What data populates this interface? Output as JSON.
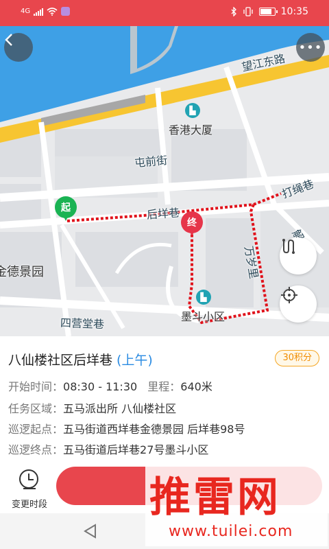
{
  "status_bar": {
    "network": "4G",
    "time": "10:35",
    "accent": "#e8464d"
  },
  "map": {
    "roads": {
      "wangjiang": "望江东路",
      "tunqian": "屯前街",
      "houyang": "后垟巷",
      "dasheng": "打绳巷",
      "wansui": "万岁里",
      "sibaitang": "四营堂巷",
      "jie": "解"
    },
    "pois": {
      "hongkong_building": "香港大厦",
      "modou_community": "墨斗小区",
      "jinde_garden": "金德景园"
    },
    "start_pin": "起",
    "end_pin": "终",
    "route_color": "#e0121b"
  },
  "task": {
    "title": "八仙楼社区后垟巷",
    "period": "(上午)",
    "points": "30积分",
    "start_time_label": "开始时间：",
    "start_time": "08:30 - 11:30",
    "distance_label": "里程：",
    "distance": "640米",
    "area_label": "任务区域：",
    "area": "五马派出所 八仙楼社区",
    "start_point_label": "巡逻起点：",
    "start_point": "五马街道西垟巷金德景园 后垟巷98号",
    "end_point_label": "巡逻终点：",
    "end_point": "五马街道后垟巷27号墨斗小区"
  },
  "actions": {
    "change_period": "变更时段"
  },
  "watermark": {
    "brand": "推雷网",
    "url": "www.tuilei.com"
  }
}
